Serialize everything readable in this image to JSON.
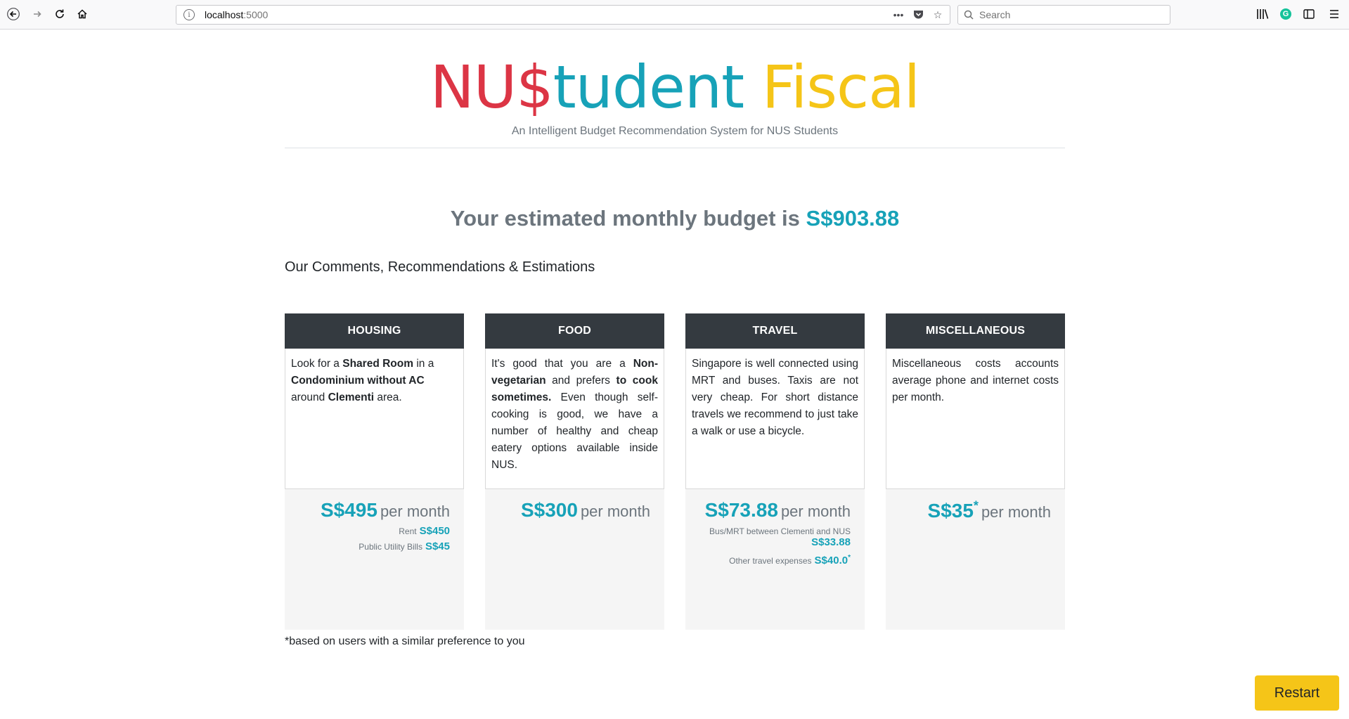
{
  "browser": {
    "url_host": "localhost",
    "url_port": ":5000",
    "search_placeholder": "Search"
  },
  "header": {
    "brand_part1": "NU$",
    "brand_part2": "tudent",
    "brand_part3": "Fiscal",
    "tagline": "An Intelligent Budget Recommendation System for NUS Students"
  },
  "budget": {
    "prefix": "Your estimated monthly budget is",
    "amount": "S$903.88"
  },
  "section_title": "Our Comments, Recommendations & Estimations",
  "cards": {
    "housing": {
      "title": "HOUSING",
      "t1": "Look for a ",
      "b1": "Shared Room",
      "t2": " in a ",
      "b2": "Condominium without AC",
      "t3": " around ",
      "b3": "Clementi",
      "t4": " area.",
      "price": "S$495",
      "per": "per month",
      "rent_label": "Rent",
      "rent_value": "S$450",
      "utility_label": "Public Utility Bills",
      "utility_value": "S$45"
    },
    "food": {
      "title": "FOOD",
      "t1": "It's good that you are a ",
      "b1": "Non-vegetarian",
      "t2": " and prefers ",
      "b2": "to cook sometimes.",
      "t3": " Even though self-cooking is good, we have a number of healthy and cheap eatery options available inside NUS.",
      "price": "S$300",
      "per": "per month"
    },
    "travel": {
      "title": "TRAVEL",
      "body": "Singapore is well connected using MRT and buses. Taxis are not very cheap. For short distance travels we recommend to just take a walk or use a bicycle.",
      "price": "S$73.88",
      "per": "per month",
      "bus_label": "Bus/MRT between Clementi and NUS",
      "bus_value": "S$33.88",
      "other_label": "Other travel expenses",
      "other_value": "S$40.0",
      "other_mark": "*"
    },
    "misc": {
      "title": "MISCELLANEOUS",
      "body": "Miscellaneous costs accounts average phone and internet costs per month.",
      "price": "S$35",
      "mark": "*",
      "per": "per month"
    }
  },
  "footnote": "*based on users with a similar preference to you",
  "restart_label": "Restart",
  "colors": {
    "brand_red": "#dc3545",
    "brand_teal": "#17a2b8",
    "brand_yellow": "#f5c518",
    "card_header": "#343a40"
  }
}
